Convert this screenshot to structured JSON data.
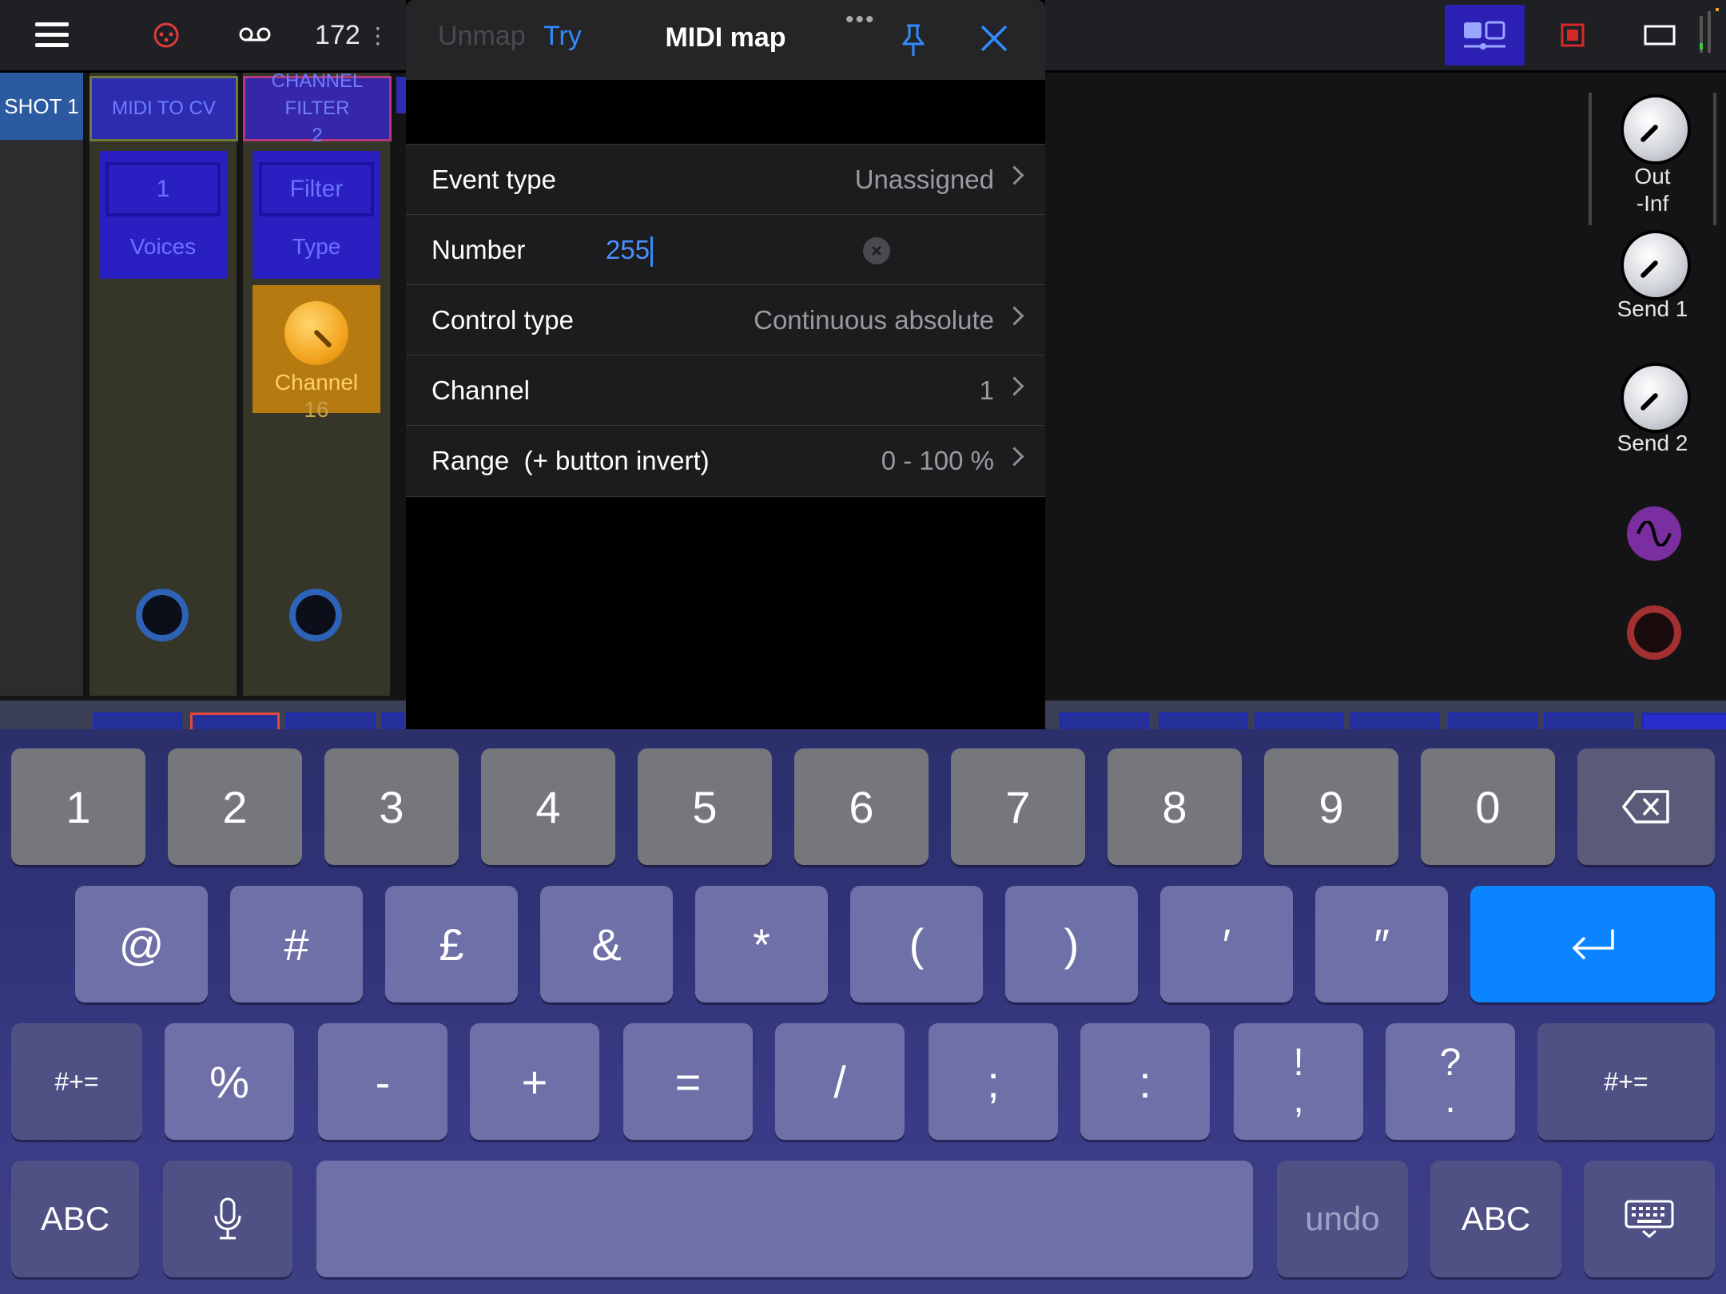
{
  "topbar": {
    "tempo": "172",
    "tempo_menu": "⋮"
  },
  "rack": {
    "columns": [
      {
        "label": "SHOT  1"
      },
      {
        "label": "MIDI TO CV",
        "param_value": "1",
        "param_caption": "Voices"
      },
      {
        "label_line1": "CHANNEL FILTER",
        "label_line2": "2",
        "param_value": "Filter",
        "param_caption": "Type",
        "knob_caption": "Channel",
        "knob_value": "16"
      }
    ],
    "right_knobs": [
      {
        "label": "Out",
        "value": "-Inf"
      },
      {
        "label": "Send 1"
      },
      {
        "label": "Send 2"
      }
    ]
  },
  "midi_map": {
    "title": "MIDI map",
    "unmap_label": "Unmap",
    "try_label": "Try",
    "rows": [
      {
        "label": "Event type",
        "value": "Unassigned"
      },
      {
        "label": "Number",
        "value": "255"
      },
      {
        "label": "Control type",
        "value": "Continuous absolute"
      },
      {
        "label": "Channel",
        "value": "1"
      },
      {
        "label": "Range",
        "extra": "(+ button invert)",
        "value": "0 - 100 %"
      }
    ]
  },
  "keyboard": {
    "row1": [
      "1",
      "2",
      "3",
      "4",
      "5",
      "6",
      "7",
      "8",
      "9",
      "0"
    ],
    "row2": [
      "@",
      "#",
      "£",
      "&",
      "*",
      "(",
      ")",
      "′",
      "″"
    ],
    "row3": [
      "#+=",
      "%",
      "-",
      "+",
      "=",
      "/",
      ";",
      ":",
      "!",
      ",",
      "?",
      ".",
      "#+="
    ],
    "row4": {
      "left": "ABC",
      "undo": "undo",
      "right": "ABC"
    }
  },
  "colors": {
    "accent_blue": "#0a84ff",
    "module_blue": "#2a1fc0",
    "knob_orange": "#f2a21b"
  }
}
